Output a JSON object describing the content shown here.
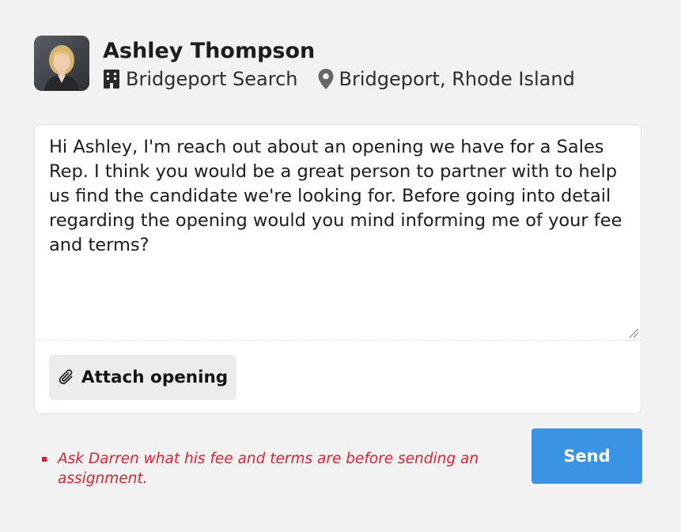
{
  "contact": {
    "name": "Ashley Thompson",
    "company": "Bridgeport Search",
    "location": "Bridgeport, Rhode Island",
    "company_icon": "building-icon",
    "location_icon": "map-pin-icon"
  },
  "message": {
    "body": "Hi Ashley, I'm reach out about an opening we have for a Sales Rep. I think you would be a great person to partner with to help us find the candidate we're looking for. Before going into detail regarding the opening would you mind informing me of your fee and terms?"
  },
  "actions": {
    "attach_label": "Attach opening",
    "attach_icon": "paperclip-icon",
    "send_label": "Send"
  },
  "note": {
    "text": "Ask Darren what his fee and terms are before sending an assignment."
  },
  "colors": {
    "send_button": "#3b93e4",
    "note_text": "#e02232",
    "background": "#f2f2f2"
  }
}
